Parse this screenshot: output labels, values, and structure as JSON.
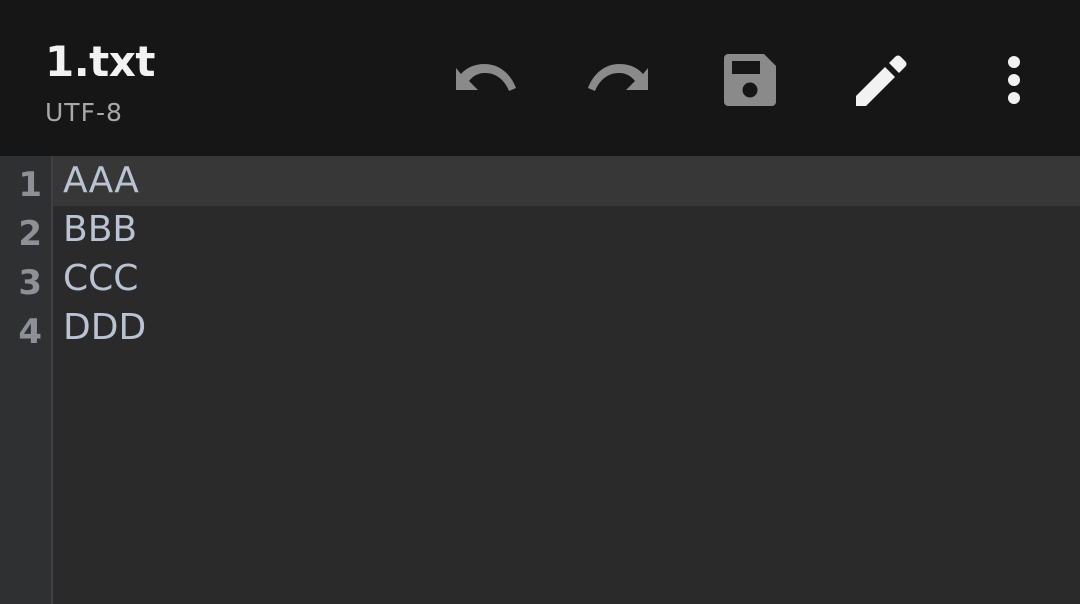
{
  "toolbar": {
    "file_name": "1.txt",
    "encoding": "UTF-8",
    "actions": [
      {
        "name": "undo",
        "icon": "undo-icon",
        "enabled": false
      },
      {
        "name": "redo",
        "icon": "redo-icon",
        "enabled": false
      },
      {
        "name": "save",
        "icon": "save-icon",
        "enabled": false
      },
      {
        "name": "edit",
        "icon": "pencil-icon",
        "enabled": true
      },
      {
        "name": "more",
        "icon": "more-vert-icon",
        "enabled": true
      }
    ]
  },
  "editor": {
    "current_line": 1,
    "lines": [
      {
        "number": "1",
        "text": "AAA"
      },
      {
        "number": "2",
        "text": "BBB"
      },
      {
        "number": "3",
        "text": "CCC"
      },
      {
        "number": "4",
        "text": "DDD"
      }
    ]
  },
  "colors": {
    "toolbar_bg": "#161616",
    "editor_bg": "#2a2a2a",
    "gutter_bg": "#2e3032",
    "current_line_bg": "#373737",
    "text": "#b9c3d3",
    "line_number": "#8d9196",
    "icon_disabled": "#8a8a8a",
    "icon_enabled": "#f2f2f2"
  }
}
